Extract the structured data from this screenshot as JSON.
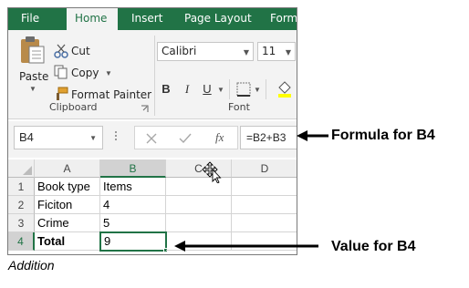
{
  "tabs": [
    "File",
    "Home",
    "Insert",
    "Page Layout",
    "Formu"
  ],
  "active_tab": "Home",
  "theme": {
    "accent": "#217346",
    "ribbon_bg": "#f3f3f3"
  },
  "clipboard": {
    "paste_label": "Paste",
    "cut_label": "Cut",
    "copy_label": "Copy",
    "format_painter_label": "Format Painter",
    "group_label": "Clipboard"
  },
  "font": {
    "family_value": "Calibri",
    "size_value": "11",
    "bold_label": "B",
    "italic_label": "I",
    "underline_label": "U",
    "group_label": "Font"
  },
  "formula_bar": {
    "name_box": "B4",
    "fx_label": "fx",
    "formula": "=B2+B3"
  },
  "grid": {
    "columns": [
      "A",
      "B",
      "C",
      "D"
    ],
    "rows": [
      {
        "num": "1",
        "cells": [
          "Book type",
          "Items",
          "",
          ""
        ]
      },
      {
        "num": "2",
        "cells": [
          "Ficiton",
          "4",
          "",
          ""
        ]
      },
      {
        "num": "3",
        "cells": [
          "Crime",
          "5",
          "",
          ""
        ]
      },
      {
        "num": "4",
        "cells": [
          "Total",
          "9",
          "",
          ""
        ]
      }
    ]
  },
  "annotations": {
    "formula_label": "Formula for B4",
    "value_label": "Value for B4",
    "caption": "Addition"
  }
}
